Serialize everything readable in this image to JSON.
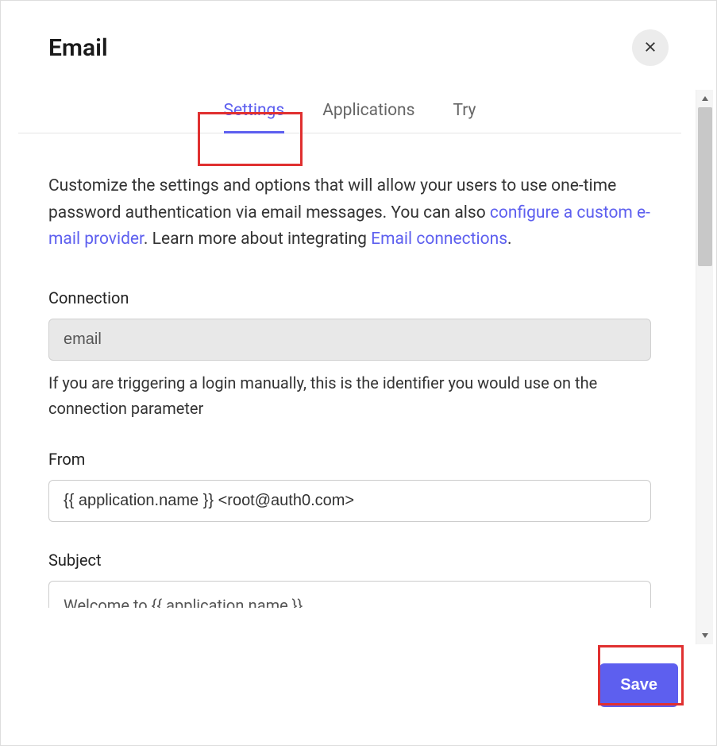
{
  "header": {
    "title": "Email"
  },
  "tabs": {
    "items": [
      {
        "label": "Settings",
        "active": true
      },
      {
        "label": "Applications",
        "active": false
      },
      {
        "label": "Try",
        "active": false
      }
    ]
  },
  "intro": {
    "part1": "Customize the settings and options that will allow your users to use one-time password authentication via email messages. You can also ",
    "link1": "configure a custom e-mail provider",
    "part2": ". Learn more about integrating ",
    "link2": "Email connections",
    "part3": "."
  },
  "fields": {
    "connection": {
      "label": "Connection",
      "value": "email",
      "help": "If you are triggering a login manually, this is the identifier you would use on the connection parameter"
    },
    "from": {
      "label": "From",
      "value": "{{ application.name }} <root@auth0.com>"
    },
    "subject": {
      "label": "Subject",
      "value": "Welcome to {{ application.name }}"
    }
  },
  "footer": {
    "save_label": "Save"
  }
}
